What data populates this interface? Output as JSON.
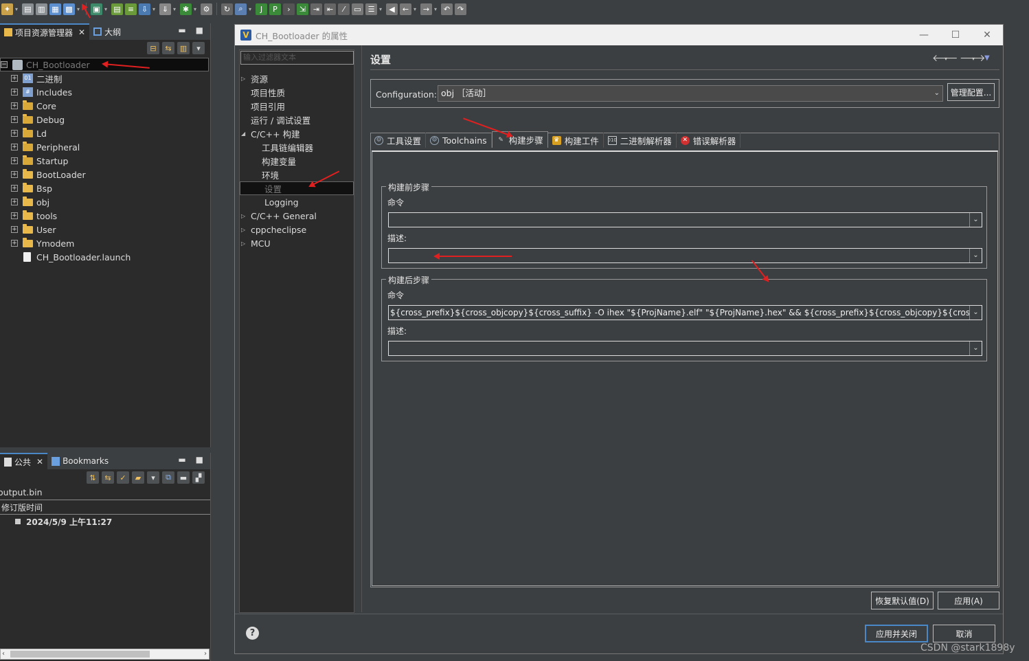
{
  "colors": {
    "accent": "#4a88c7",
    "annotation": "#e02020",
    "folder": "#e8b84a"
  },
  "toolbar": {
    "icons": [
      "new-icon",
      "save-icon",
      "save-all-icon",
      "open-icon",
      "grid-icon",
      "image-icon",
      "book-icon",
      "build-icon",
      "download-icon",
      "debug-icon",
      "gear-icon",
      "refresh-icon",
      "search-icon",
      "code-icon",
      "page-icon",
      "terminal-icon",
      "export-icon",
      "align-icon",
      "align2-icon",
      "slash-icon",
      "window-icon",
      "layers-icon",
      "stack-icon",
      "back-icon",
      "prev-icon",
      "forward-icon",
      "undo-icon",
      "redo-icon"
    ]
  },
  "explorer": {
    "tabs": [
      {
        "label": "项目资源管理器"
      },
      {
        "label": "大纲"
      }
    ],
    "project": "CH_Bootloader",
    "items": [
      {
        "label": "二进制",
        "icon": "binary-icon"
      },
      {
        "label": "Includes",
        "icon": "includes-icon"
      },
      {
        "label": "Core",
        "icon": "source-folder-icon"
      },
      {
        "label": "Debug",
        "icon": "source-folder-icon"
      },
      {
        "label": "Ld",
        "icon": "source-folder-icon"
      },
      {
        "label": "Peripheral",
        "icon": "source-folder-icon"
      },
      {
        "label": "Startup",
        "icon": "source-folder-icon"
      },
      {
        "label": "BootLoader",
        "icon": "folder-icon"
      },
      {
        "label": "Bsp",
        "icon": "folder-icon"
      },
      {
        "label": "obj",
        "icon": "folder-icon"
      },
      {
        "label": "tools",
        "icon": "folder-icon"
      },
      {
        "label": "User",
        "icon": "folder-icon"
      },
      {
        "label": "Ymodem",
        "icon": "folder-icon"
      }
    ],
    "launch_file": "CH_Bootloader.launch"
  },
  "bottom_panel": {
    "tabs": [
      {
        "label": "公共"
      },
      {
        "label": "Bookmarks"
      }
    ],
    "file": "output.bin",
    "column": "修订版时间",
    "row_value": "2024/5/9 上午11:27"
  },
  "dialog": {
    "title": "CH_Bootloader 的属性",
    "filter_placeholder": "输入过滤器文本",
    "nav": {
      "resource": "资源",
      "project_nature": "项目性质",
      "project_ref": "项目引用",
      "run_debug": "运行 / 调试设置",
      "cpp_build": "C/C++ 构建",
      "toolchain_editor": "工具链编辑器",
      "build_vars": "构建变量",
      "env": "环境",
      "settings": "设置",
      "logging": "Logging",
      "cpp_general": "C/C++ General",
      "cppcheclipse": "cppcheclipse",
      "mcu": "MCU"
    },
    "page_title": "设置",
    "config_label": "Configuration:",
    "config_value": "obj ［活动］",
    "manage_btn": "管理配置...",
    "tabs": {
      "tool_settings": "工具设置",
      "toolchains": "Toolchains",
      "build_steps": "构建步骤",
      "build_artifact": "构建工件",
      "binary_parsers": "二进制解析器",
      "error_parsers": "错误解析器"
    },
    "pre_build": {
      "title": "构建前步骤",
      "command_label": "命令",
      "command_value": "",
      "desc_label": "描述:",
      "desc_value": ""
    },
    "post_build": {
      "title": "构建后步骤",
      "command_label": "命令",
      "command_value": "${cross_prefix}${cross_objcopy}${cross_suffix} -O ihex \"${ProjName}.elf\" \"${ProjName}.hex\" && ${cross_prefix}${cross_objcopy}${cross_suffix} -O b",
      "desc_label": "描述:",
      "desc_value": ""
    },
    "restore_defaults": "恢复默认值(D)",
    "apply": "应用(A)",
    "apply_close": "应用并关闭",
    "cancel": "取消"
  },
  "watermark": "CSDN @stark1898y"
}
